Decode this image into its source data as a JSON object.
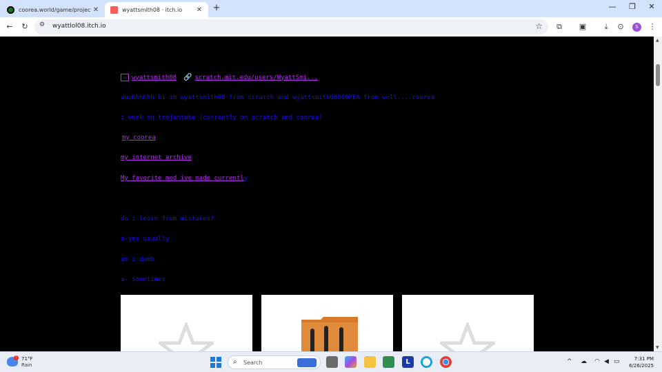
{
  "browser": {
    "tabs": [
      {
        "title": "coorea.world/game/projects/...",
        "active": false
      },
      {
        "title": "wyattsmith08 · itch.io",
        "active": true
      }
    ],
    "address": "wyattlol08.itch.io"
  },
  "page": {
    "username": "wyattsmith08",
    "scratch_link": "scratch.mit.edu/users/WyattSmi...",
    "intro": "uuuhhhhhh hi im wyattsmith08 from scratch and wyattsmith08000PEA from well....coorea",
    "work": "i work on trojantube (currently on scratch and coorea)",
    "link_coorea": "my coorea",
    "link_archive": "my internet archive",
    "link_mod": "My favorite mod ive made currentl",
    "link_mod_tail": "y",
    "q1": "do i learn from mistakes?",
    "a1": "a-yes usually",
    "q2": "am i dumb",
    "a2": "a- sometimes"
  },
  "taskbar": {
    "temp": "71°F",
    "condition": "Rain",
    "search_placeholder": "Search",
    "time": "7:31 PM",
    "date": "6/26/2025"
  },
  "colors": {
    "text_blue": "#1a10e8",
    "link_purple": "#b02ee8",
    "page_bg": "#000000"
  }
}
